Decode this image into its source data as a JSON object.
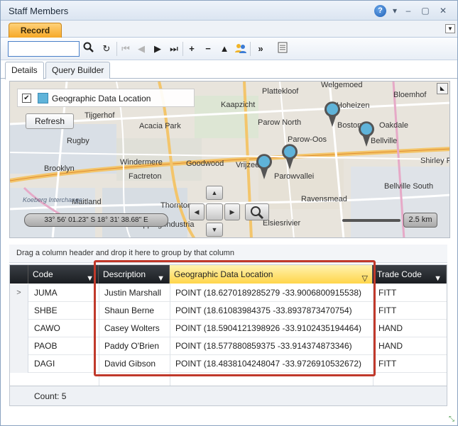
{
  "window": {
    "title": "Staff Members"
  },
  "tabs": {
    "record_label": "Record"
  },
  "toolbar": {
    "search_value": ""
  },
  "subtabs": [
    "Details",
    "Query Builder"
  ],
  "map": {
    "legend_label": "Geographic Data Location",
    "refresh_label": "Refresh",
    "coordinates": "33° 56' 01.23\" S 18° 31' 38.68\" E",
    "scale": "2.5 km",
    "places": [
      {
        "name": "Plattekloof"
      },
      {
        "name": "Welgemoed"
      },
      {
        "name": "Bloemhof"
      },
      {
        "name": "Kaapzicht"
      },
      {
        "name": "Hoheizen"
      },
      {
        "name": "Tijgerhof"
      },
      {
        "name": "Parow North"
      },
      {
        "name": "Boston"
      },
      {
        "name": "Oakdale"
      },
      {
        "name": "Acacia Park"
      },
      {
        "name": "Parow-Oos"
      },
      {
        "name": "Rugby"
      },
      {
        "name": "Bellville"
      },
      {
        "name": "Windermere"
      },
      {
        "name": "Goodwood"
      },
      {
        "name": "Vrijzee"
      },
      {
        "name": "Shirley Pa"
      },
      {
        "name": "Brooklyn"
      },
      {
        "name": "Factreton"
      },
      {
        "name": "Parowvallei"
      },
      {
        "name": "Maitland"
      },
      {
        "name": "Ravensmead"
      },
      {
        "name": "Bellville South"
      },
      {
        "name": "Elsiesrivier"
      },
      {
        "name": "Thornton"
      },
      {
        "name": "Epping Industria"
      },
      {
        "name": "Koeberg Interchange"
      }
    ],
    "marker_color": "#5fb3d9"
  },
  "grid": {
    "group_hint": "Drag a column header and drop it here to group by that column",
    "columns": [
      "Code",
      "Description",
      "Geographic Data Location",
      "Trade Code"
    ],
    "rows": [
      {
        "code": "JUMA",
        "description": "Justin Marshall",
        "location": "POINT (18.6270189285279 -33.9006800915538)",
        "trade": "FITT"
      },
      {
        "code": "SHBE",
        "description": "Shaun Berne",
        "location": "POINT (18.61083984375 -33.8937873470754)",
        "trade": "FITT"
      },
      {
        "code": "CAWO",
        "description": "Casey Wolters",
        "location": "POINT (18.5904121398926 -33.9102435194464)",
        "trade": "HAND"
      },
      {
        "code": "PAOB",
        "description": "Paddy O'Brien",
        "location": "POINT (18.577880859375 -33.914374873346)",
        "trade": "HAND"
      },
      {
        "code": "DAGI",
        "description": "David Gibson",
        "location": "POINT (18.4838104248047 -33.9726910532672)",
        "trade": "FITT"
      }
    ],
    "footer_count": "Count: 5",
    "selected_row_indicator": ">"
  },
  "colors": {
    "accent_orange": "#f5a623",
    "highlight_red": "#c0392b",
    "header_dark": "#1b1e22"
  }
}
